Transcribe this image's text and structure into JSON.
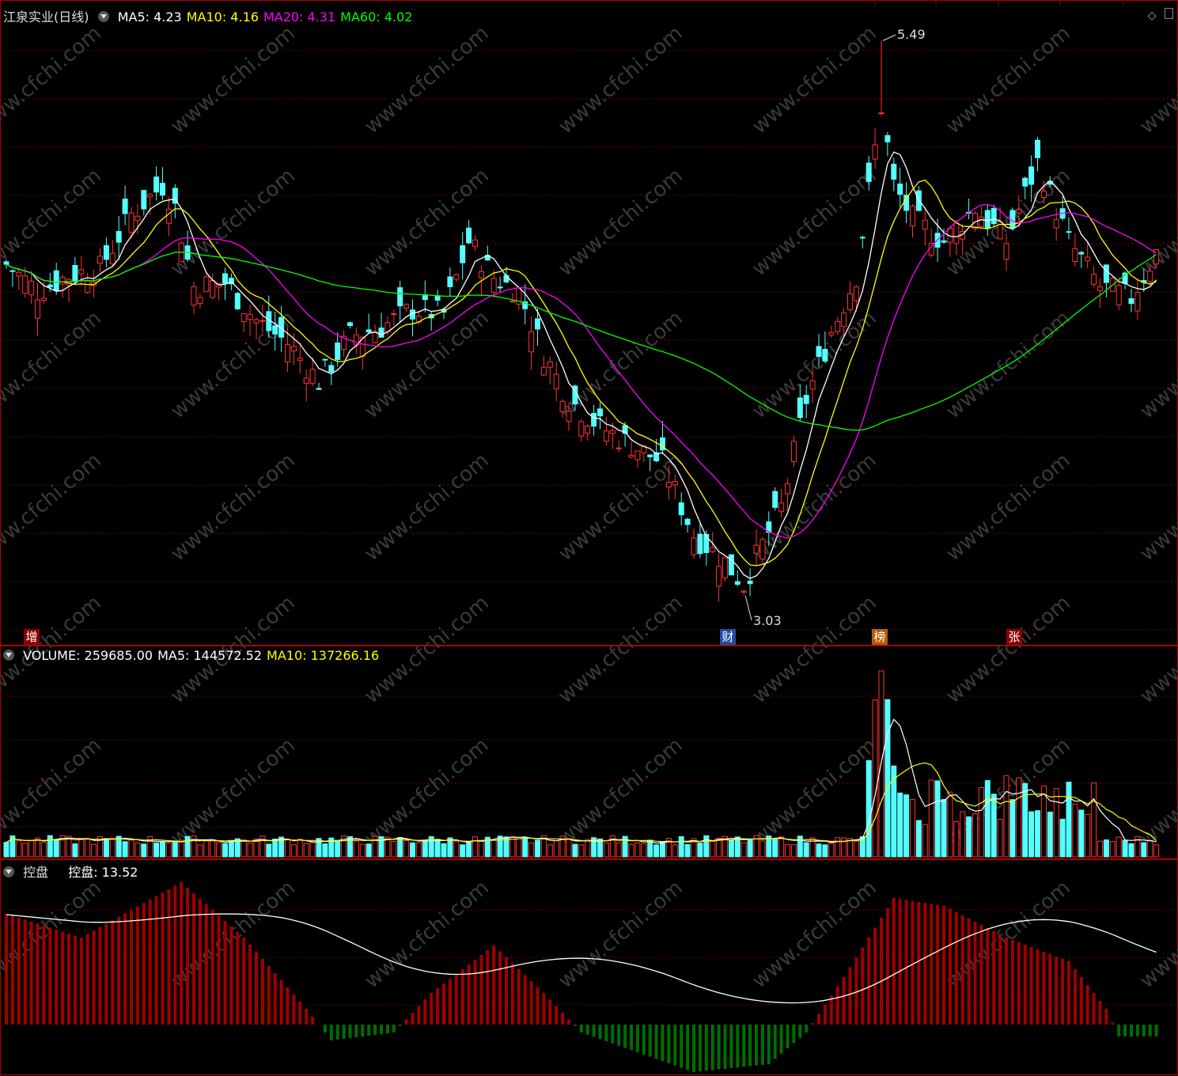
{
  "main_panel": {
    "stock_title": "江泉实业(日线)",
    "ma_labels": [
      {
        "label": "MA5: 4.23",
        "color": "#ffffff"
      },
      {
        "label": "MA10: 4.16",
        "color": "#ffff00"
      },
      {
        "label": "MA20: 4.31",
        "color": "#ff00ff"
      },
      {
        "label": "MA60: 4.02",
        "color": "#00ff00"
      }
    ],
    "high_label": "5.49",
    "low_label": "3.03",
    "event_markers": [
      {
        "text": "增",
        "color": "#8b0000"
      },
      {
        "text": "财",
        "color": "#1e4fa0"
      },
      {
        "text": "榜",
        "color": "#b85c00"
      },
      {
        "text": "张",
        "color": "#8b0000"
      }
    ]
  },
  "volume_panel": {
    "labels": [
      {
        "label": "VOLUME: 259685.00",
        "color": "#ffffff"
      },
      {
        "label": "MA5: 144572.52",
        "color": "#ffffff"
      },
      {
        "label": "MA10: 137266.16",
        "color": "#ffff00"
      }
    ]
  },
  "indicator_panel": {
    "name": "控盘",
    "labels": [
      {
        "label": "控盘: 13.52",
        "color": "#ffffff"
      }
    ]
  },
  "watermark": "www.cfchi.com",
  "colors": {
    "up": "#ff3333",
    "down": "#54ffff",
    "grid": "#7a0000",
    "indicator_pos": "#a00000",
    "indicator_neg": "#006e00"
  },
  "chart_data": {
    "type": "candlestick",
    "price_axis_range": [
      2.9,
      5.6
    ],
    "high": 5.49,
    "low": 3.03,
    "current": {
      "MA5": 4.23,
      "MA10": 4.16,
      "MA20": 4.31,
      "MA60": 4.02
    },
    "volume": 259685.0,
    "volume_ma5": 144572.52,
    "volume_ma10": 137266.16,
    "control_value": 13.52
  }
}
